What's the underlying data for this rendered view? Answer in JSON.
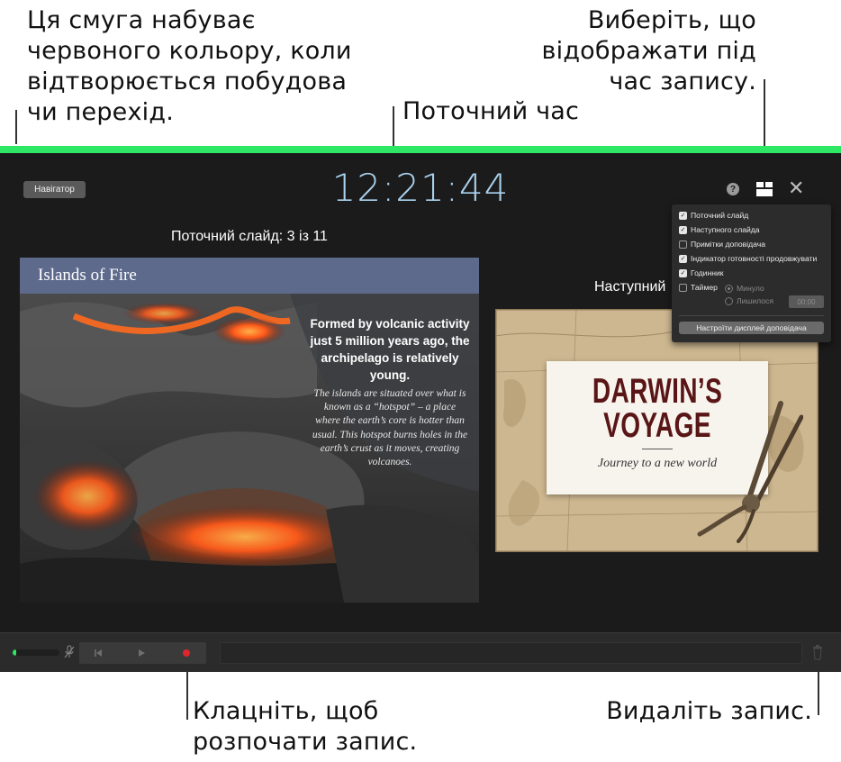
{
  "callouts": {
    "top_left": [
      "Ця смуга набуває",
      "червоного кольору, коли",
      "відтворюється побудова",
      "чи перехід."
    ],
    "top_center": "Поточний час",
    "top_right": [
      "Виберіть, що",
      "відображати під",
      "час запису."
    ],
    "bottom_left": [
      "Клацніть, щоб",
      "розпочати запис."
    ],
    "bottom_right": "Видаліть запис."
  },
  "colors": {
    "status_bar": "#2ee865",
    "clock": "#a9d1ee",
    "record": "#e0262c",
    "presenter_bg": "#1b1b1b"
  },
  "toolbar": {
    "navigator_label": "Навігатор",
    "clock": "12:21:44",
    "help_icon_glyph": "?",
    "close_icon_glyph": "✕"
  },
  "current": {
    "label": "Поточний слайд: 3 із 11",
    "slide_title": "Islands of Fire",
    "paragraph1": "Formed by volcanic activity just 5 million years ago, the archipelago is relatively young.",
    "paragraph2": "The islands are situated over what is known as a “hotspot” – a place where the earth’s core is hotter than usual. This hotspot burns holes in the earth’s crust as it moves, creating volcanoes."
  },
  "next": {
    "label": "Наступний",
    "title_line1": "DARWIN’S",
    "title_line2": "VOYAGE",
    "subtitle": "Journey to a new world"
  },
  "layout_menu": {
    "items": [
      {
        "label": "Поточний слайд",
        "checked": true
      },
      {
        "label": "Наступного слайда",
        "checked": true
      },
      {
        "label": "Примітки доповідача",
        "checked": false
      },
      {
        "label": "Індикатор готовності продовжувати",
        "checked": true
      },
      {
        "label": "Годинник",
        "checked": true
      },
      {
        "label": "Таймер",
        "checked": false
      }
    ],
    "timer_elapsed": "Минуло",
    "timer_remaining": "Лишилося",
    "timer_value": "00:00",
    "settings_button": "Настроїти дисплей доповідача"
  },
  "recording": {
    "level": 0.08,
    "mic_icon": "mic-muted-icon",
    "skip_back_icon": "skip-back-icon",
    "play_icon": "play-icon",
    "record_icon": "record-icon",
    "trash_icon": "trash-icon"
  }
}
